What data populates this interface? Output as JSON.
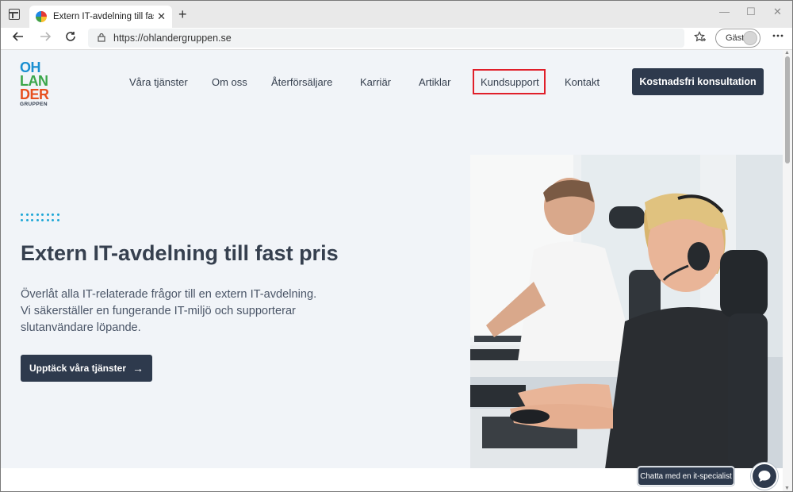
{
  "browser": {
    "tab_title": "Extern IT-avdelning till fast pris",
    "tab_close_glyph": "✕",
    "new_tab_glyph": "+",
    "window_controls": {
      "minimize": "—",
      "maximize": "☐",
      "close": "✕"
    },
    "url": "https://ohlandergruppen.se",
    "profile_label": "Gäst",
    "icons": [
      "tab-actions-icon",
      "back-icon",
      "forward-icon",
      "refresh-icon",
      "lock-icon",
      "favorites-icon",
      "profile-avatar-icon",
      "more-icon"
    ]
  },
  "site": {
    "logo": {
      "line1": "OH",
      "line2": "LAN",
      "line3": "DER",
      "line4": "GRUPPEN"
    },
    "nav": [
      {
        "label": "Våra tjänster"
      },
      {
        "label": "Om oss"
      },
      {
        "label": "Återförsäljare"
      },
      {
        "label": "Karriär"
      },
      {
        "label": "Artiklar"
      },
      {
        "label": "Kundsupport",
        "highlighted": true
      },
      {
        "label": "Kontakt"
      }
    ],
    "cta_button": "Kostnadsfri konsultation",
    "hero": {
      "title": "Extern IT-avdelning till fast pris",
      "text_lines": [
        "Överlåt alla IT-relaterade frågor till en extern IT-avdelning.",
        "Vi säkerställer en fungerande IT-miljö och supporterar",
        "slutanvändare löpande."
      ],
      "button": "Upptäck våra tjänster",
      "button_arrow": "→"
    },
    "chat": {
      "label": "Chatta med en it-specialist",
      "icon": "chat-icon"
    }
  },
  "colors": {
    "accent_dark": "#2e3a4d",
    "highlight_red": "#e01f2a",
    "dots_blue": "#1ea7d6",
    "page_bg": "#f1f4f8"
  }
}
